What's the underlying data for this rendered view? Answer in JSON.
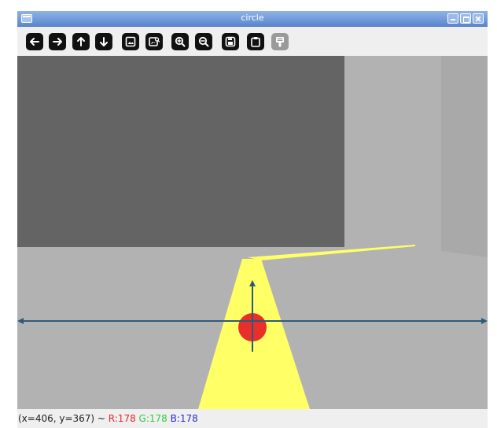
{
  "window": {
    "title": "circle"
  },
  "toolbar": {
    "buttons": [
      {
        "icon": "arrow-left-icon"
      },
      {
        "icon": "arrow-right-icon"
      },
      {
        "icon": "arrow-up-icon"
      },
      {
        "icon": "arrow-down-icon"
      },
      {
        "icon": "image-icon"
      },
      {
        "icon": "image-search-icon"
      },
      {
        "icon": "zoom-in-icon"
      },
      {
        "icon": "zoom-out-icon"
      },
      {
        "icon": "save-icon"
      },
      {
        "icon": "clipboard-icon"
      },
      {
        "icon": "properties-icon"
      }
    ]
  },
  "status": {
    "coords": "(x=406, y=367) ~ ",
    "r": "R:178",
    "g": "G:178",
    "b": "B:178",
    "colors": {
      "r": "#e8262a",
      "g": "#2ecc40",
      "b": "#2a2ad9"
    }
  },
  "scene": {
    "colors": {
      "back_wall": "#646464",
      "side_wall": "#a9a9a9",
      "floor": "#b2b2b2",
      "path": "#ffff66",
      "ball": "#e8302a",
      "axes": "#2e5a7a"
    }
  }
}
